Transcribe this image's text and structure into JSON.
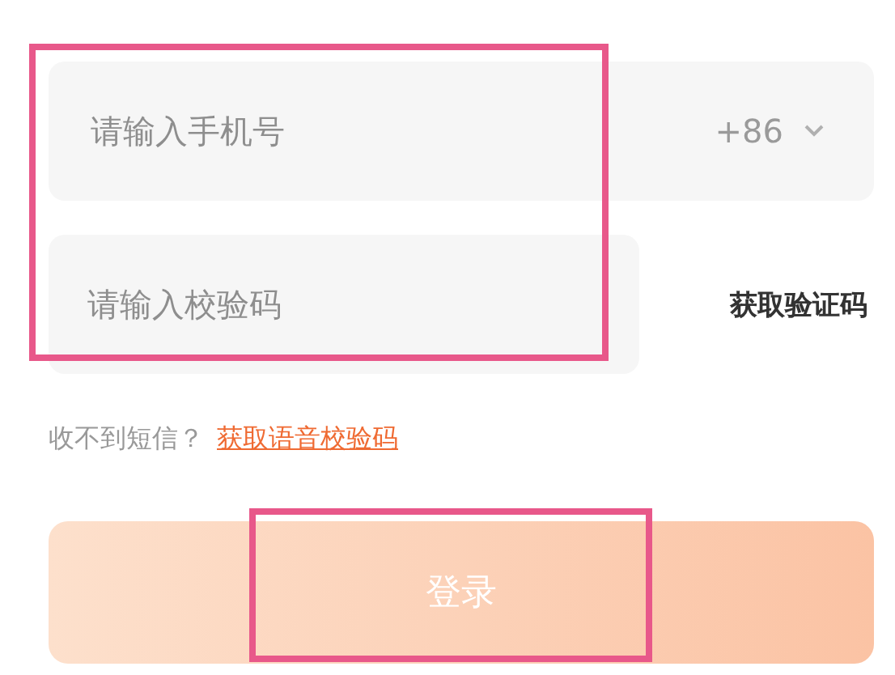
{
  "phone_field": {
    "placeholder": "请输入手机号",
    "country_code": "+86"
  },
  "code_field": {
    "placeholder": "请输入校验码"
  },
  "get_code_button": "获取验证码",
  "voice_hint": {
    "text": "收不到短信？",
    "link": "获取语音校验码"
  },
  "login_button": "登录"
}
